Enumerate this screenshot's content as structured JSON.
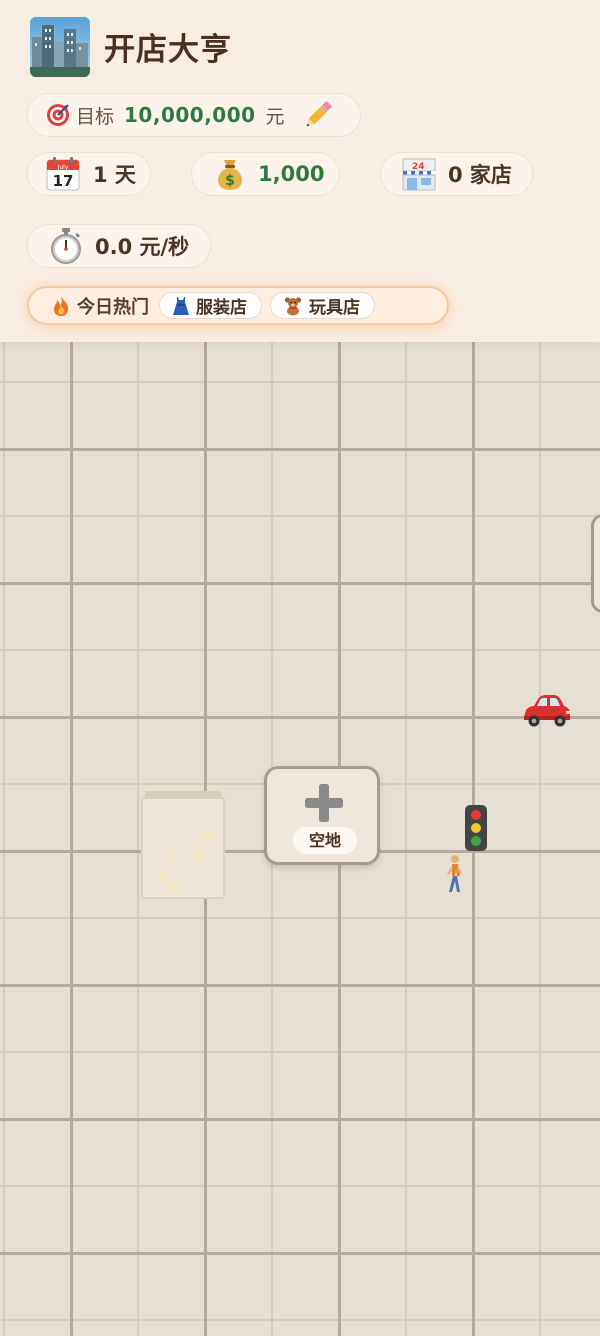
{
  "header": {
    "title": "开店大亨",
    "goal": {
      "label": "目标",
      "value": "10,000,000",
      "unit": "元"
    },
    "stats": {
      "day": "1 天",
      "money": "1,000",
      "stores": "0 家店",
      "income_rate": "0.0 元/秒"
    },
    "hot_today": {
      "label": "今日热门",
      "items": [
        {
          "label": "服装店",
          "icon": "dress-icon"
        },
        {
          "label": "玩具店",
          "icon": "teddy-bear-icon"
        }
      ]
    }
  },
  "map": {
    "empty_lot": {
      "label": "空地",
      "icon": "plus-icon"
    },
    "decor": [
      "red-car-icon",
      "traffic-light-icon",
      "pedestrian-icon"
    ]
  },
  "colors": {
    "header_bg": "#f8ede3",
    "money_green": "#2e7a3e",
    "hot_border": "#f5c99a",
    "map_bg": "#e6dfd4"
  }
}
